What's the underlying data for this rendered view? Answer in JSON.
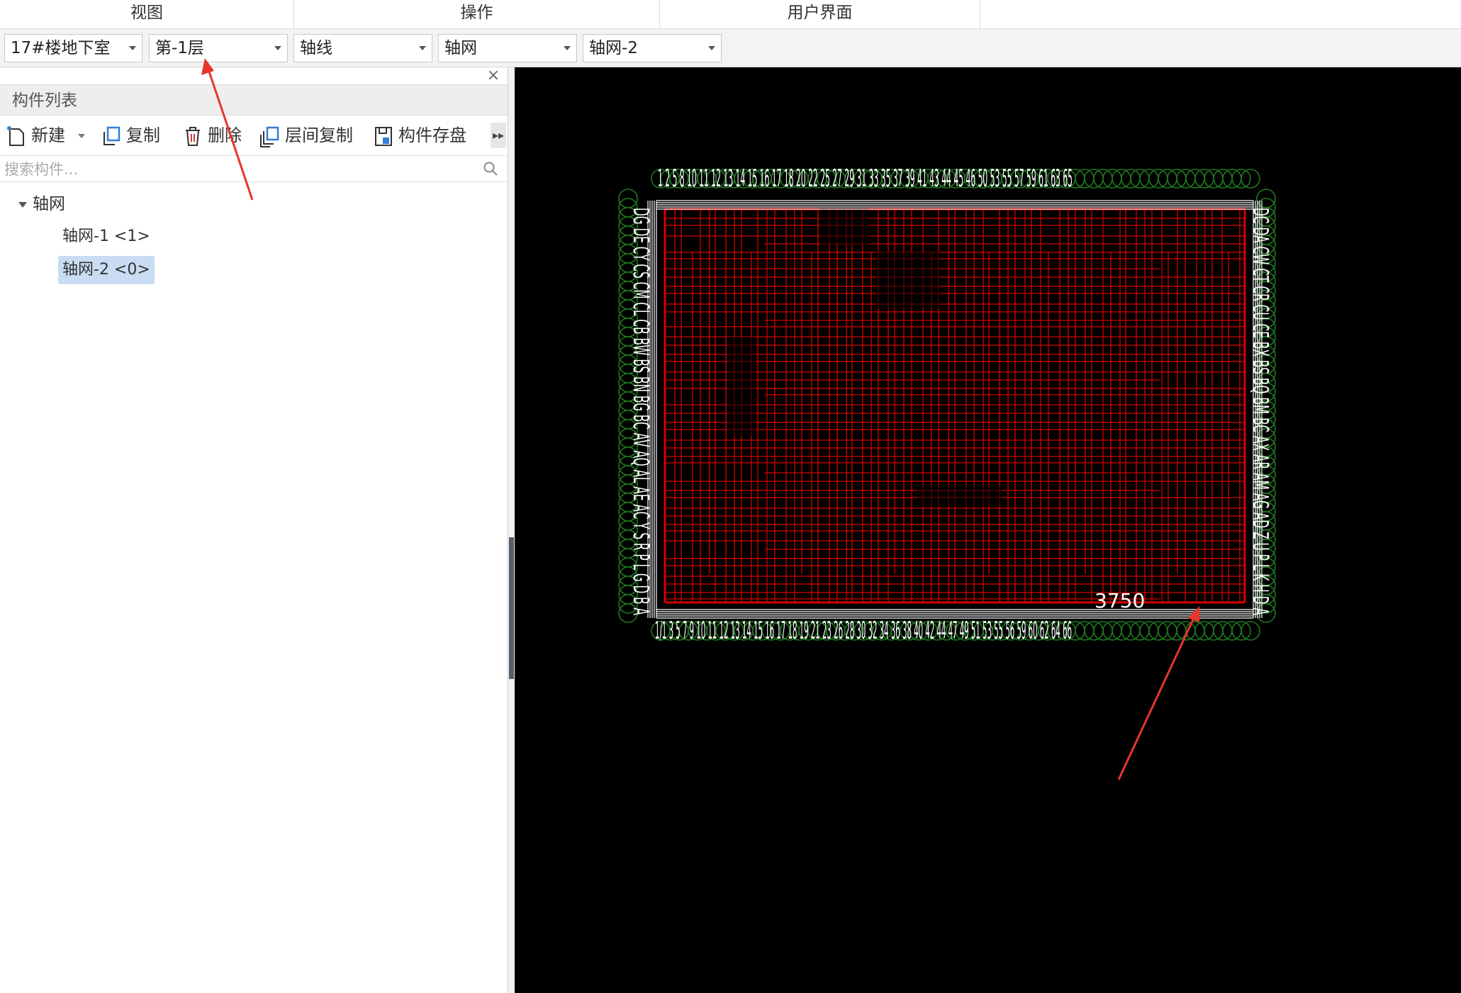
{
  "ribbon": {
    "groups": [
      "视图",
      "操作",
      "用户界面"
    ]
  },
  "selectors": {
    "building": "17#楼地下室",
    "floor": "第-1层",
    "category": "轴线",
    "type": "轴网",
    "component": "轴网-2"
  },
  "panel": {
    "title": "构件列表",
    "toolbar": {
      "new_label": "新建",
      "copy_label": "复制",
      "delete_label": "删除",
      "floor_copy_label": "层间复制",
      "save_label": "构件存盘"
    },
    "search_placeholder": "搜索构件...",
    "tree": {
      "root_label": "轴网",
      "items": [
        {
          "label": "轴网-1 <1>",
          "selected": false
        },
        {
          "label": "轴网-2 <0>",
          "selected": true
        }
      ]
    }
  },
  "canvas": {
    "background": "#000000",
    "grid_color": "#d40000",
    "bubble_color": "#1f7a1f",
    "dimension_text": "3750",
    "top_axis_labels": "1 2 5 8 10 11 12 13 14 15 16 17 18 20 22 25 27 29 31 33 35 37 39 41 43 44 45 46 50 53 55 57 59 61 63 65",
    "bottom_axis_labels": "1/1 3 5 7 9 10 11 12 13 14 15 16 17 18 19 21 23 26 28 30 32 34 36 38 40 42 44 47 49 51 53 55 56 59 60 62 64 66",
    "left_axis_labels": "DG DE CY CS CM CL CB BW BS BN BG BC AV AQ AL AE AC Y S R P L G D B A",
    "right_axis_labels": "DC DA CW CT CR CU CE BX BS BQ BM BC AX AR AM AG AD Z U P L K H D A"
  },
  "annotations": {
    "arrow_color": "#e8352b"
  }
}
